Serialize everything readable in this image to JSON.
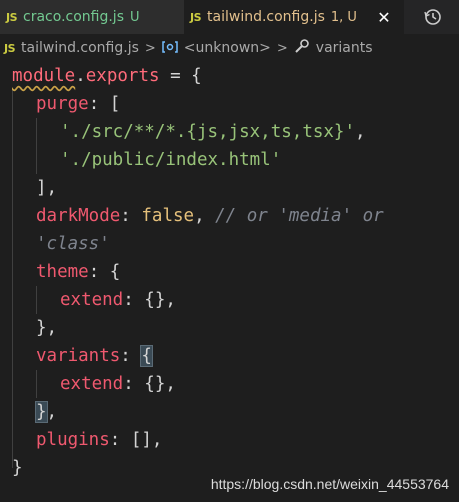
{
  "tabs": [
    {
      "badge": "JS",
      "name": "craco.config.js",
      "status": "U"
    },
    {
      "badge": "JS",
      "name": "tailwind.config.js",
      "status": "1, U"
    }
  ],
  "breadcrumb": {
    "badge": "JS",
    "file": "tailwind.config.js",
    "sep": ">",
    "symbol": "<unknown>",
    "leaf": "variants"
  },
  "code": {
    "l1": {
      "a": "module",
      "b": ".",
      "c": "exports",
      "d": " = {"
    },
    "l2": {
      "k": "purge",
      "p": ": ["
    },
    "l3": {
      "s": "'./src/**/*.{js,jsx,ts,tsx}'",
      "p": ","
    },
    "l4": {
      "s": "'./public/index.html'"
    },
    "l5": {
      "p": "],"
    },
    "l6": {
      "k": "darkMode",
      "p": ": ",
      "v": "false",
      "p2": ", ",
      "c": "// or 'media' or"
    },
    "l7": {
      "c": "'class'"
    },
    "l8": {
      "k": "theme",
      "p": ": {"
    },
    "l9": {
      "k": "extend",
      "p": ": {},"
    },
    "l10": {
      "p": "},"
    },
    "l11": {
      "k": "variants",
      "p": ": ",
      "b": "{"
    },
    "l12": {
      "k": "extend",
      "p": ": {},"
    },
    "l13": {
      "b": "}",
      "p": ","
    },
    "l14": {
      "k": "plugins",
      "p": ": [],"
    },
    "l15": {
      "p": "}"
    }
  },
  "watermark": "https://blog.csdn.net/weixin_44553764",
  "icons": {
    "close": "close-icon",
    "history": "history-icon",
    "wrench": "wrench-icon",
    "ref": "reference-icon"
  }
}
